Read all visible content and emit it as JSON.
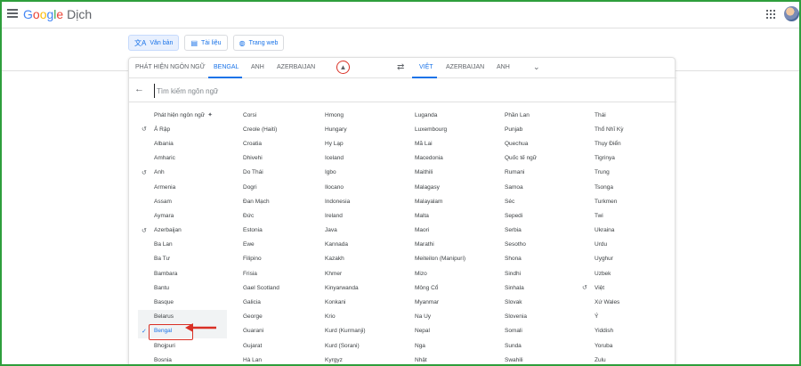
{
  "app": {
    "logo_google": "Google",
    "logo_product": "Dịch"
  },
  "modes": [
    {
      "label": "Văn bản",
      "icon": "translate-icon"
    },
    {
      "label": "Tài liệu",
      "icon": "document-icon"
    },
    {
      "label": "Trang web",
      "icon": "globe-icon"
    }
  ],
  "source_tabs": [
    "PHÁT HIỆN NGÔN NGỮ",
    "BENGAL",
    "ANH",
    "AZERBAIJAN"
  ],
  "target_tabs": [
    "VIỆT",
    "AZERBAIJAN",
    "ANH"
  ],
  "search": {
    "placeholder": "Tìm kiếm ngôn ngữ",
    "value": ""
  },
  "languages": {
    "col1": [
      "Phát hiện ngôn ngữ",
      "Ả Rập",
      "Albania",
      "Amharic",
      "Anh",
      "Armenia",
      "Assam",
      "Aymara",
      "Azerbaijan",
      "Ba Lan",
      "Ba Tư",
      "Bambara",
      "Bantu",
      "Basque",
      "Belarus",
      "Bengal",
      "Bhojpuri",
      "Bosnia"
    ],
    "col2": [
      "Corsi",
      "Creole (Haiti)",
      "Croatia",
      "Dhivehi",
      "Do Thái",
      "Dogri",
      "Đan Mạch",
      "Đức",
      "Estonia",
      "Ewe",
      "Filipino",
      "Frisia",
      "Gael Scotland",
      "Galicia",
      "George",
      "Guarani",
      "Gujarat",
      "Hà Lan"
    ],
    "col3": [
      "Hmong",
      "Hungary",
      "Hy Lạp",
      "Iceland",
      "Igbo",
      "Ilocano",
      "Indonesia",
      "Ireland",
      "Java",
      "Kannada",
      "Kazakh",
      "Khmer",
      "Kinyarwanda",
      "Konkani",
      "Krio",
      "Kurd (Kurmanji)",
      "Kurd (Sorani)",
      "Kyrgyz"
    ],
    "col4": [
      "Luganda",
      "Luxembourg",
      "Mã Lai",
      "Macedonia",
      "Maithili",
      "Malagasy",
      "Malayalam",
      "Malta",
      "Maori",
      "Marathi",
      "Meiteilon (Manipuri)",
      "Mizo",
      "Mông Cổ",
      "Myanmar",
      "Na Uy",
      "Nepal",
      "Nga",
      "Nhật"
    ],
    "col5": [
      "Phần Lan",
      "Punjab",
      "Quechua",
      "Quốc tế ngữ",
      "Rumani",
      "Samoa",
      "Séc",
      "Sepedi",
      "Serbia",
      "Sesotho",
      "Shona",
      "Sindhi",
      "Sinhala",
      "Slovak",
      "Slovenia",
      "Somali",
      "Sunda",
      "Swahili"
    ],
    "col6": [
      "Thái",
      "Thổ Nhĩ Kỳ",
      "Thụy Điển",
      "Tigrinya",
      "Trung",
      "Tsonga",
      "Turkmen",
      "Twi",
      "Ukraina",
      "Urdu",
      "Uyghur",
      "Uzbek",
      "Việt",
      "Xứ Wales",
      "Ý",
      "Yiddish",
      "Yoruba",
      "Zulu"
    ]
  },
  "recent_languages": [
    "Ả Rập",
    "Anh",
    "Azerbaijan",
    "Việt"
  ],
  "selected_language": "Bengal",
  "colors": {
    "accent": "#1a73e8",
    "annotation": "#d93025",
    "frame": "#2e9e3c"
  }
}
